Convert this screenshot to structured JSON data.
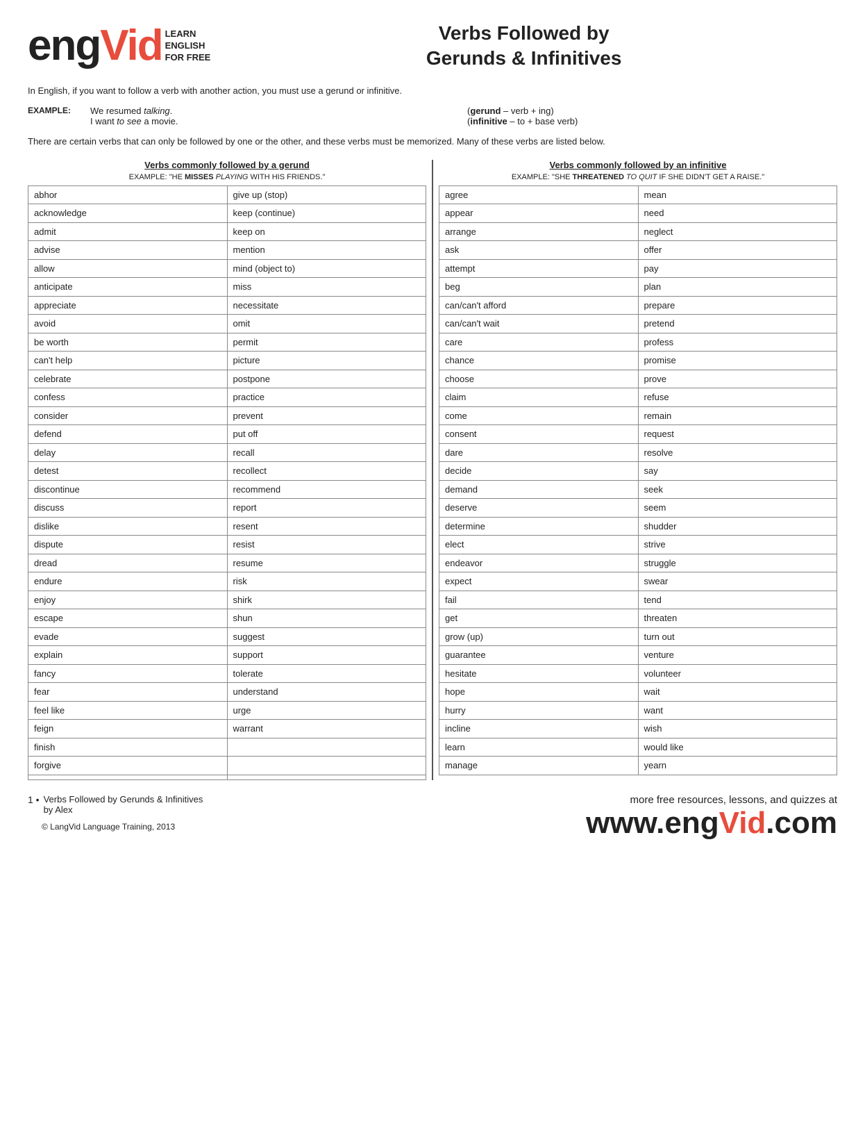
{
  "header": {
    "logo_eng": "eng",
    "logo_vid": "Vid",
    "logo_sub1": "LEARN",
    "logo_sub2": "ENGLISH",
    "logo_sub3": "FOR FREE",
    "title_line1": "Verbs Followed by",
    "title_line2": "Gerunds & Infinitives"
  },
  "intro": {
    "text": "In English, if you want to follow a verb with another action, you must use a gerund or infinitive.",
    "example_label": "EXAMPLE:",
    "example1_sentence": "We resumed ",
    "example1_italic": "talking",
    "example1_sentence2": ".",
    "example2_sentence": "I want ",
    "example2_italic": "to see",
    "example2_sentence2": " a movie.",
    "def1_bold": "gerund",
    "def1_rest": " – verb + ing)",
    "def2_bold": "infinitive",
    "def2_rest": " – to + base verb)",
    "second_para": "There are certain verbs that can only be followed by one or the other, and these verbs must be memorized. Many of these verbs are listed below."
  },
  "gerund_section": {
    "header": "Verbs commonly followed by a gerund",
    "example_label": "EXAMPLE:",
    "example_pre": "\"He ",
    "example_bold": "misses",
    "example_italic": " playing",
    "example_post": " with his friends.\"",
    "words_col1": [
      "abhor",
      "acknowledge",
      "admit",
      "advise",
      "allow",
      "anticipate",
      "appreciate",
      "avoid",
      "be worth",
      "can't help",
      "celebrate",
      "confess",
      "consider",
      "defend",
      "delay",
      "detest",
      "discontinue",
      "discuss",
      "dislike",
      "dispute",
      "dread",
      "endure",
      "enjoy",
      "escape",
      "evade",
      "explain",
      "fancy",
      "fear",
      "feel like",
      "feign",
      "finish",
      "forgive"
    ],
    "words_col2": [
      "give up (stop)",
      "keep (continue)",
      "keep on",
      "mention",
      "mind (object to)",
      "miss",
      "necessitate",
      "omit",
      "permit",
      "picture",
      "postpone",
      "practice",
      "prevent",
      "put off",
      "recall",
      "recollect",
      "recommend",
      "report",
      "resent",
      "resist",
      "resume",
      "risk",
      "shirk",
      "shun",
      "suggest",
      "support",
      "tolerate",
      "understand",
      "urge",
      "warrant",
      "",
      "",
      ""
    ]
  },
  "infinitive_section": {
    "header": "Verbs commonly followed by an infinitive",
    "example_label": "EXAMPLE:",
    "example_pre": "\"She ",
    "example_bold": "threatened",
    "example_italic": " to quit",
    "example_post": " if she didn't get a raise.\"",
    "words_col1": [
      "agree",
      "appear",
      "arrange",
      "ask",
      "attempt",
      "beg",
      "can/can't afford",
      "can/can't wait",
      "care",
      "chance",
      "choose",
      "claim",
      "come",
      "consent",
      "dare",
      "decide",
      "demand",
      "deserve",
      "determine",
      "elect",
      "endeavor",
      "expect",
      "fail",
      "get",
      "grow (up)",
      "guarantee",
      "hesitate",
      "hope",
      "hurry",
      "incline",
      "learn",
      "manage"
    ],
    "words_col2": [
      "mean",
      "need",
      "neglect",
      "offer",
      "pay",
      "plan",
      "prepare",
      "pretend",
      "profess",
      "promise",
      "prove",
      "refuse",
      "remain",
      "request",
      "resolve",
      "say",
      "seek",
      "seem",
      "shudder",
      "strive",
      "struggle",
      "swear",
      "tend",
      "threaten",
      "turn out",
      "venture",
      "volunteer",
      "wait",
      "want",
      "wish",
      "would like",
      "yearn"
    ]
  },
  "footer": {
    "bullet_number": "1",
    "bullet_text1": "Verbs Followed by Gerunds & Infinitives",
    "bullet_text2": "by Alex",
    "copyright": "© LangVid Language Training, 2013",
    "more_text": "more free resources, lessons, and quizzes at",
    "site_url_pre": "www.",
    "site_url_eng": "eng",
    "site_url_vid": "Vid",
    "site_url_post": ".com"
  }
}
